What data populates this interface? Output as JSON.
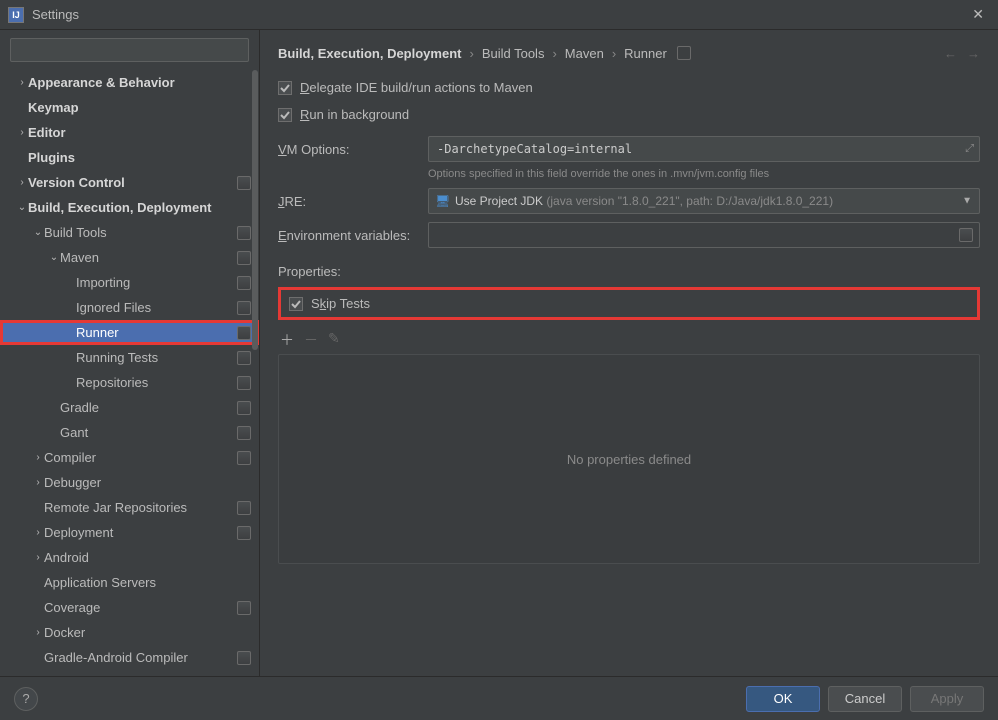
{
  "window": {
    "title": "Settings"
  },
  "search": {
    "placeholder": ""
  },
  "sidebar": {
    "items": [
      {
        "label": "Appearance & Behavior",
        "arrow": ">",
        "indent": 0,
        "bold": true
      },
      {
        "label": "Keymap",
        "arrow": "",
        "indent": 0,
        "bold": true
      },
      {
        "label": "Editor",
        "arrow": ">",
        "indent": 0,
        "bold": true
      },
      {
        "label": "Plugins",
        "arrow": "",
        "indent": 0,
        "bold": true
      },
      {
        "label": "Version Control",
        "arrow": ">",
        "indent": 0,
        "bold": true,
        "badge": true
      },
      {
        "label": "Build, Execution, Deployment",
        "arrow": "v",
        "indent": 0,
        "bold": true
      },
      {
        "label": "Build Tools",
        "arrow": "v",
        "indent": 1,
        "badge": true
      },
      {
        "label": "Maven",
        "arrow": "v",
        "indent": 2,
        "badge": true
      },
      {
        "label": "Importing",
        "arrow": "",
        "indent": 3,
        "badge": true
      },
      {
        "label": "Ignored Files",
        "arrow": "",
        "indent": 3,
        "badge": true
      },
      {
        "label": "Runner",
        "arrow": "",
        "indent": 3,
        "badge": true,
        "selected": true,
        "highlight": true
      },
      {
        "label": "Running Tests",
        "arrow": "",
        "indent": 3,
        "badge": true
      },
      {
        "label": "Repositories",
        "arrow": "",
        "indent": 3,
        "badge": true
      },
      {
        "label": "Gradle",
        "arrow": "",
        "indent": 2,
        "badge": true
      },
      {
        "label": "Gant",
        "arrow": "",
        "indent": 2,
        "badge": true
      },
      {
        "label": "Compiler",
        "arrow": ">",
        "indent": 1,
        "badge": true
      },
      {
        "label": "Debugger",
        "arrow": ">",
        "indent": 1
      },
      {
        "label": "Remote Jar Repositories",
        "arrow": "",
        "indent": 1,
        "badge": true
      },
      {
        "label": "Deployment",
        "arrow": ">",
        "indent": 1,
        "badge": true
      },
      {
        "label": "Android",
        "arrow": ">",
        "indent": 1
      },
      {
        "label": "Application Servers",
        "arrow": "",
        "indent": 1
      },
      {
        "label": "Coverage",
        "arrow": "",
        "indent": 1,
        "badge": true
      },
      {
        "label": "Docker",
        "arrow": ">",
        "indent": 1
      },
      {
        "label": "Gradle-Android Compiler",
        "arrow": "",
        "indent": 1,
        "badge": true
      }
    ]
  },
  "breadcrumb": {
    "items": [
      "Build, Execution, Deployment",
      "Build Tools",
      "Maven",
      "Runner"
    ]
  },
  "checks": {
    "delegate": "Delegate IDE build/run actions to Maven",
    "background": "Run in background",
    "delegate_mnemonic": "D",
    "background_mnemonic": "R"
  },
  "form": {
    "vmoptions_label": "VM Options:",
    "vmoptions_mnemonic": "V",
    "vmoptions_value": "-DarchetypeCatalog=internal",
    "hint": "Options specified in this field override the ones in .mvn/jvm.config files",
    "jre_label": "JRE:",
    "jre_mnemonic": "J",
    "jre_value_prefix": "Use Project JDK",
    "jre_value_detail": "(java version \"1.8.0_221\", path: D:/Java/jdk1.8.0_221)",
    "env_label": "Environment variables:",
    "env_mnemonic": "E"
  },
  "properties": {
    "label": "Properties:",
    "skip_tests": "Skip Tests",
    "skip_mnemonic": "k",
    "empty": "No properties defined"
  },
  "footer": {
    "ok": "OK",
    "cancel": "Cancel",
    "apply": "Apply"
  }
}
